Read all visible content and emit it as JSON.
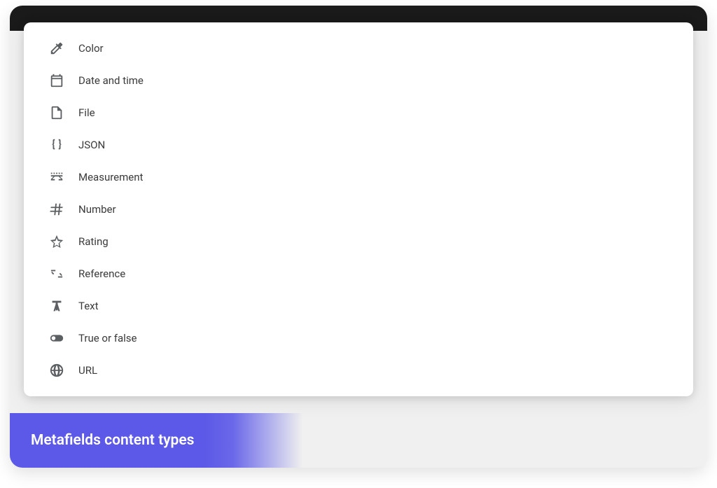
{
  "footer": {
    "title": "Metafields content types"
  },
  "options": [
    {
      "icon": "eyedropper",
      "label": "Color"
    },
    {
      "icon": "calendar",
      "label": "Date and time"
    },
    {
      "icon": "file",
      "label": "File"
    },
    {
      "icon": "json",
      "label": "JSON"
    },
    {
      "icon": "measurement",
      "label": "Measurement"
    },
    {
      "icon": "hash",
      "label": "Number"
    },
    {
      "icon": "star",
      "label": "Rating"
    },
    {
      "icon": "reference",
      "label": "Reference"
    },
    {
      "icon": "text",
      "label": "Text"
    },
    {
      "icon": "toggle",
      "label": "True or false"
    },
    {
      "icon": "globe",
      "label": "URL"
    }
  ]
}
